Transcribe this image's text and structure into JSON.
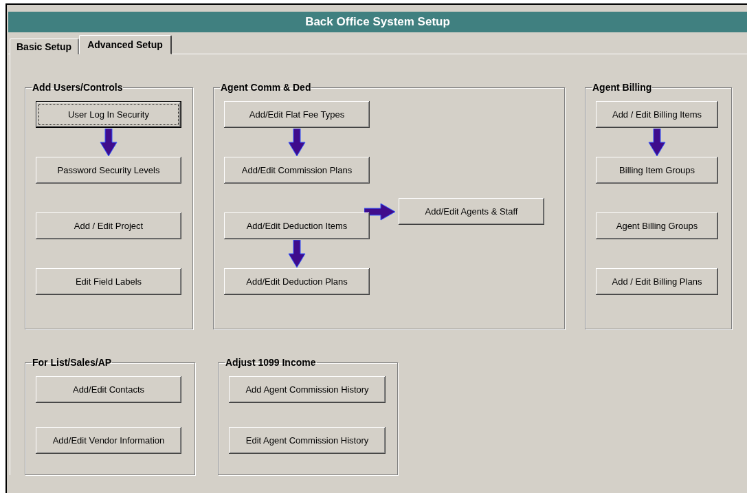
{
  "window": {
    "title": "Back Office System Setup"
  },
  "tabs": [
    {
      "label": "Basic Setup",
      "selected": false
    },
    {
      "label": "Advanced Setup",
      "selected": true
    }
  ],
  "group_rows": [
    [
      {
        "title": "Add Users/Controls",
        "columns": [
          [
            {
              "kind": "button",
              "label": "User Log In Security",
              "focused": true
            },
            {
              "kind": "down-arrow"
            },
            {
              "kind": "button",
              "label": "Password Security Levels",
              "focused": false
            },
            {
              "kind": "button",
              "label": "Add / Edit Project",
              "focused": false
            },
            {
              "kind": "button",
              "label": "Edit Field Labels",
              "focused": false
            }
          ]
        ]
      },
      {
        "title": "Agent Comm & Ded",
        "columns": [
          [
            {
              "kind": "button",
              "label": "Add/Edit Flat Fee Types",
              "focused": false
            },
            {
              "kind": "down-arrow"
            },
            {
              "kind": "button",
              "label": "Add/Edit Commission Plans",
              "focused": false
            },
            {
              "kind": "button",
              "label": "Add/Edit Deduction Items",
              "focused": false
            },
            {
              "kind": "down-arrow"
            },
            {
              "kind": "button",
              "label": "Add/Edit Deduction Plans",
              "focused": false
            }
          ],
          [
            {
              "kind": "right-arrow"
            },
            {
              "kind": "button",
              "label": "Add/Edit Agents & Staff",
              "focused": false
            }
          ]
        ]
      },
      {
        "title": "Agent Billing",
        "columns": [
          [
            {
              "kind": "button",
              "label": "Add / Edit Billing Items",
              "focused": false
            },
            {
              "kind": "down-arrow"
            },
            {
              "kind": "button",
              "label": "Billing Item Groups",
              "focused": false
            },
            {
              "kind": "button",
              "label": "Agent Billing Groups",
              "focused": false
            },
            {
              "kind": "button",
              "label": "Add / Edit Billing Plans",
              "focused": false
            }
          ]
        ]
      }
    ],
    [
      {
        "title": "For List/Sales/AP",
        "columns": [
          [
            {
              "kind": "button",
              "label": "Add/Edit Contacts",
              "focused": false
            },
            {
              "kind": "button",
              "label": "Add/Edit Vendor Information",
              "focused": false
            }
          ]
        ]
      },
      {
        "title": "Adjust 1099 Income",
        "columns": [
          [
            {
              "kind": "button",
              "label": "Add Agent Commission History",
              "focused": false
            },
            {
              "kind": "button",
              "label": "Edit Agent Commission History",
              "focused": false
            }
          ]
        ]
      }
    ]
  ]
}
